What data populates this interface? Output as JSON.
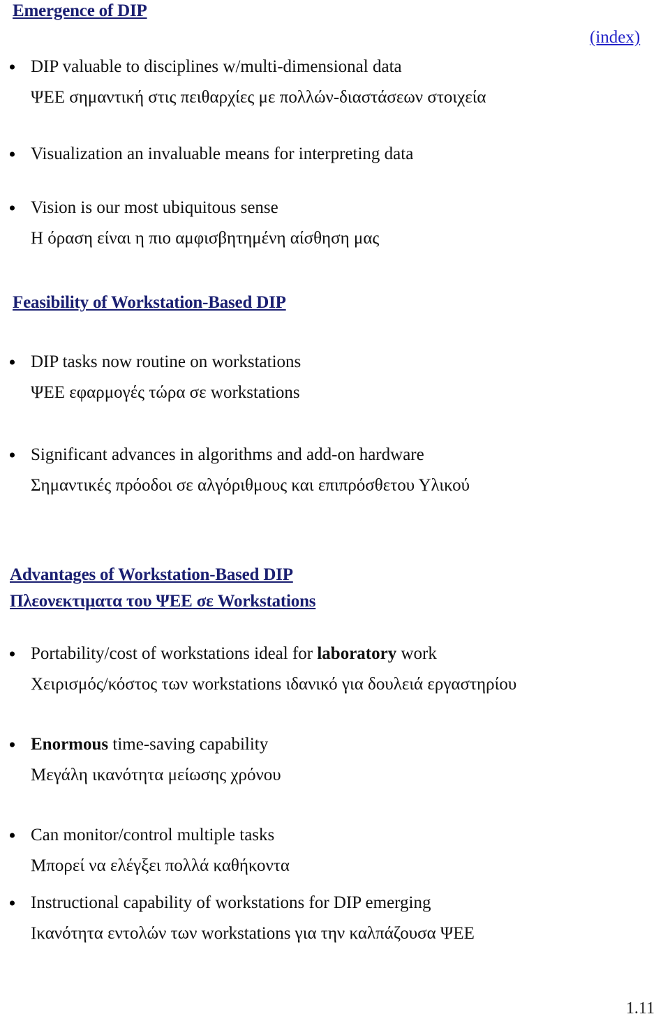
{
  "document": {
    "page_number": "1.11",
    "index_link": "(index)",
    "accent_heading_color": "#1a1f71",
    "link_color": "#2323c8",
    "body_text_color": "#111111"
  },
  "sections": [
    {
      "heading": "Emergence of DIP",
      "bullets": [
        {
          "en": "DIP valuable to disciplines w/multi-dimensional data",
          "gr": "ΨΕΕ σημαντική στις πειθαρχίες με πολλών-διαστάσεων στοιχεία"
        },
        {
          "en": "Visualization an invaluable means for interpreting data",
          "gr": ""
        },
        {
          "en": "Vision is our most ubiquitous sense",
          "gr": "Η όραση είναι η πιο αμφισβητημένη αίσθηση μας"
        }
      ]
    },
    {
      "heading": "Feasibility of Workstation-Based DIP",
      "bullets": [
        {
          "en": "DIP tasks now routine on workstations",
          "gr": "ΨΕΕ εφαρμογές τώρα σε workstations"
        },
        {
          "en": "Significant advances in algorithms and add-on hardware",
          "gr": "Σημαντικές πρόοδοι σε αλγόριθμους και επιπρόσθετου Υλικού"
        }
      ]
    },
    {
      "heading": "Advantages of Workstation-Based DIP",
      "heading_gr": "Πλεονεκτιματα του ΨΕΕ σε Workstations",
      "bullets": [
        {
          "en_pre": "Portability/cost of workstations ideal for ",
          "en_bold": "laboratory",
          "en_post": " work",
          "gr": "Χειρισμός/κόστος των workstations ιδανικό για δουλειά εργαστηρίου"
        },
        {
          "en_bold": "Enormous",
          "en_post": " time-saving capability",
          "gr": "Μεγάλη ικανότητα μείωσης χρόνου"
        },
        {
          "en": "Can monitor/control multiple tasks",
          "gr": "Μπορεί να ελέγξει πολλά καθήκοντα"
        },
        {
          "en": "Instructional capability of workstations for DIP emerging",
          "gr": "Ικανότητα εντολών των workstations για την καλπάζουσα ΨΕΕ"
        }
      ]
    }
  ]
}
